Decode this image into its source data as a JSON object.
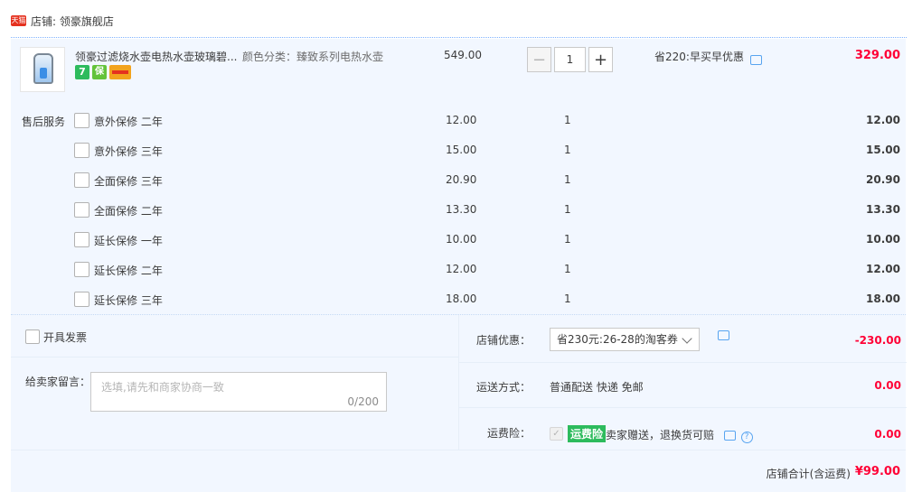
{
  "shop": {
    "badge": "天猫",
    "label": "店铺: 领豪旗舰店"
  },
  "product": {
    "title": "领豪过滤烧水壶电热水壶玻璃碧...",
    "attr": "颜色分类：臻致系列电热水壶",
    "badges": [
      "7",
      "保"
    ],
    "price": "549.00",
    "quantity": "1",
    "promo": "省220:早买早优惠",
    "total": "329.00"
  },
  "services": {
    "label": "售后服务",
    "items": [
      {
        "name": "意外保修 二年",
        "price": "12.00",
        "qty": "1",
        "total": "12.00"
      },
      {
        "name": "意外保修 三年",
        "price": "15.00",
        "qty": "1",
        "total": "15.00"
      },
      {
        "name": "全面保修 三年",
        "price": "20.90",
        "qty": "1",
        "total": "20.90"
      },
      {
        "name": "全面保修 二年",
        "price": "13.30",
        "qty": "1",
        "total": "13.30"
      },
      {
        "name": "延长保修 一年",
        "price": "10.00",
        "qty": "1",
        "total": "10.00"
      },
      {
        "name": "延长保修 二年",
        "price": "12.00",
        "qty": "1",
        "total": "12.00"
      },
      {
        "name": "延长保修 三年",
        "price": "18.00",
        "qty": "1",
        "total": "18.00"
      }
    ]
  },
  "invoice": {
    "label": "开具发票"
  },
  "message": {
    "label": "给卖家留言：",
    "placeholder": "选填,请先和商家协商一致",
    "count": "0/200"
  },
  "shop_discount": {
    "label": "店铺优惠：",
    "selected": "省230元:26-28的淘客券",
    "amount": "-230.00"
  },
  "shipping": {
    "label": "运送方式：",
    "value": "普通配送 快递 免邮",
    "amount": "0.00"
  },
  "insurance": {
    "label": "运费险：",
    "tag": "运费险",
    "text": "卖家赠送，退换货可赔",
    "amount": "0.00"
  },
  "summary": {
    "label": "店铺合计(含运费)",
    "total": "¥99.00"
  },
  "colors": {
    "accent_red": "#ff0036",
    "panel_bg": "#f2f7ff",
    "link_blue": "#58a4f0",
    "green": "#2dbb5d"
  }
}
